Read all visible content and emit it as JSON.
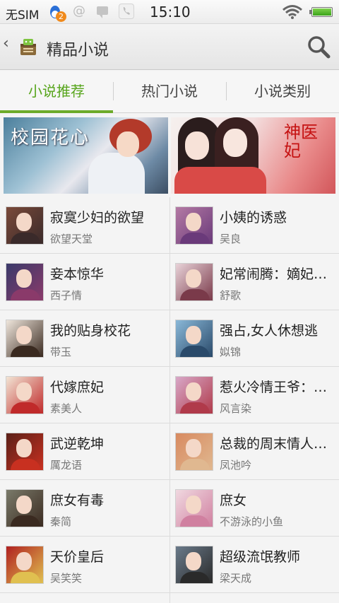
{
  "status_bar": {
    "carrier": "无SIM",
    "qq_badge": "2",
    "time": "15:10",
    "icons": [
      "qq-icon",
      "at-icon",
      "chat-icon",
      "phone-icon",
      "wifi-icon",
      "battery-icon"
    ],
    "battery_level": 1.0
  },
  "action_bar": {
    "back_glyph": "‹",
    "title": "精品小说"
  },
  "tabs": [
    {
      "label": "小说推荐",
      "active": true
    },
    {
      "label": "热门小说",
      "active": false
    },
    {
      "label": "小说类别",
      "active": false
    }
  ],
  "banners": [
    {
      "title": "校园花心"
    },
    {
      "title": "神医妃"
    }
  ],
  "books": [
    {
      "title": "寂寞少妇的欲望",
      "author": "欲望天堂",
      "cover": "#7a4a3a",
      "accent": "#3a2a2a"
    },
    {
      "title": "小姨的诱惑",
      "author": "吴良",
      "cover": "#b47aa4",
      "accent": "#6a3a7a"
    },
    {
      "title": "妾本惊华",
      "author": "西子情",
      "cover": "#3a3a6a",
      "accent": "#8a3a6a"
    },
    {
      "title": "妃常闹腾：嫡妃…",
      "author": "舒歌",
      "cover": "#e8d2d8",
      "accent": "#7a3a4a"
    },
    {
      "title": "我的贴身校花",
      "author": "带玉",
      "cover": "#efe6dc",
      "accent": "#3a2a20"
    },
    {
      "title": "强占,女人休想逃",
      "author": "姒锦",
      "cover": "#8ab8d8",
      "accent": "#2a4a6a"
    },
    {
      "title": "代嫁庶妃",
      "author": "素美人",
      "cover": "#f2e4d4",
      "accent": "#c02a2a"
    },
    {
      "title": "惹火冷情王爷：…",
      "author": "风言染",
      "cover": "#d8a8c8",
      "accent": "#b03a4a"
    },
    {
      "title": "武逆乾坤",
      "author": "厲龙语",
      "cover": "#5a2018",
      "accent": "#c83020"
    },
    {
      "title": "总裁的周末情人…",
      "author": "凤池吟",
      "cover": "#d88a60",
      "accent": "#e0b890"
    },
    {
      "title": "庶女有毒",
      "author": "秦简",
      "cover": "#7a7a6a",
      "accent": "#3a2a20"
    },
    {
      "title": "庶女",
      "author": "不游泳的小鱼",
      "cover": "#f0d8e0",
      "accent": "#d080a0"
    },
    {
      "title": "天价皇后",
      "author": "吴笑笑",
      "cover": "#b02020",
      "accent": "#e0c050"
    },
    {
      "title": "超级流氓教师",
      "author": "梁天成",
      "cover": "#6a7a8a",
      "accent": "#2a2a2a"
    }
  ]
}
